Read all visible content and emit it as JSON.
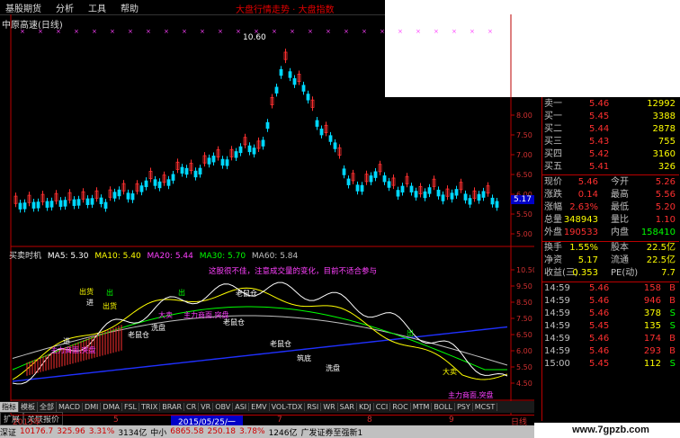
{
  "menu": {
    "items": [
      "基股期货",
      "分析",
      "工具",
      "帮助"
    ],
    "title": "大盘行情走势 · 大盘指数"
  },
  "stock": {
    "name": "中原高速(日线)"
  },
  "chart": {
    "peak_label": "10.60",
    "price_axis": [
      "8.00",
      "7.50",
      "7.00",
      "6.50",
      "6.00",
      "5.50",
      "5.00"
    ],
    "current_price_tag": "5.17",
    "indicator_axis": [
      "10.50",
      "9.50",
      "8.50",
      "7.50",
      "6.50",
      "6.00",
      "5.50",
      "4.50"
    ],
    "annotation": "这股很不佳，注意成交量的变化，目前不适合参与",
    "labels": [
      {
        "t": "出货",
        "c": "#ffff00"
      },
      {
        "t": "进",
        "c": "#ffffff"
      },
      {
        "t": "出",
        "c": "#00ff00"
      },
      {
        "t": "进",
        "c": "#ffffff"
      },
      {
        "t": "大卖",
        "c": "#ff40ff"
      },
      {
        "t": "老鼠仓",
        "c": "#ffffff"
      },
      {
        "t": "洗盘",
        "c": "#ffffff"
      },
      {
        "t": "出",
        "c": "#00ff00"
      },
      {
        "t": "老鼠仓",
        "c": "#ffffff"
      },
      {
        "t": "主力商面,突盘",
        "c": "#ff40ff"
      },
      {
        "t": "出货",
        "c": "#ffff00"
      },
      {
        "t": "老鼠仓",
        "c": "#ffffff"
      },
      {
        "t": "主力商面,突盘",
        "c": "#ff40ff"
      },
      {
        "t": "出",
        "c": "#00ff00"
      },
      {
        "t": "老鼠仓",
        "c": "#ffffff"
      },
      {
        "t": "主力商面,突盘",
        "c": "#ff40ff"
      },
      {
        "t": "筑底",
        "c": "#ffffff"
      },
      {
        "t": "洗盘",
        "c": "#ffffff"
      },
      {
        "t": "大卖",
        "c": "#ffff00"
      }
    ]
  },
  "ma_legend": {
    "name": "买卖时机",
    "items": [
      {
        "label": "MA5: 5.30",
        "color": "#ffffff"
      },
      {
        "label": "MA10: 5.40",
        "color": "#ffff00"
      },
      {
        "label": "MA20: 5.44",
        "color": "#ff40ff"
      },
      {
        "label": "MA30: 5.70",
        "color": "#00ff00"
      },
      {
        "label": "MA60: 5.84",
        "color": "#c0c0c0"
      }
    ]
  },
  "xaxis": {
    "labels": [
      "2015年",
      "5",
      "2015/05/25/一",
      "7",
      "8",
      "9",
      "日线"
    ]
  },
  "tabs": [
    "指标",
    "模板",
    "全部",
    "MACD",
    "DMI",
    "DMA",
    "FSL",
    "TRIX",
    "BRAR",
    "CR",
    "VR",
    "OBV",
    "ASI",
    "EMV",
    "VOL-TDX",
    "RSI",
    "WR",
    "SAR",
    "KDJ",
    "CCI",
    "ROC",
    "MTM",
    "BOLL",
    "PSY",
    "MCST"
  ],
  "tabs2": [
    "扩展",
    "关联报价"
  ],
  "quote": {
    "asks": [
      {
        "l": "卖一",
        "p": "5.46",
        "v": "12992"
      },
      {
        "l": "买一",
        "p": "5.45",
        "v": "3388"
      },
      {
        "l": "买二",
        "p": "5.44",
        "v": "2878"
      },
      {
        "l": "买三",
        "p": "5.43",
        "v": "755"
      },
      {
        "l": "买四",
        "p": "5.42",
        "v": "3160"
      },
      {
        "l": "买五",
        "p": "5.41",
        "v": "326"
      }
    ],
    "stats": [
      {
        "a": "现价",
        "b": "5.46",
        "c": "今开",
        "d": "5.26",
        "bc": "#ff3030",
        "dc": "#ff3030"
      },
      {
        "a": "涨跌",
        "b": "0.14",
        "c": "最高",
        "d": "5.56",
        "bc": "#ff3030",
        "dc": "#ff3030"
      },
      {
        "a": "涨幅",
        "b": "2.63%",
        "c": "最低",
        "d": "5.20",
        "bc": "#ff3030",
        "dc": "#ff3030"
      },
      {
        "a": "总量",
        "b": "348943",
        "c": "量比",
        "d": "1.10",
        "bc": "#ffff00",
        "dc": "#ff3030"
      },
      {
        "a": "外盘",
        "b": "190533",
        "c": "内盘",
        "d": "158410",
        "bc": "#ff3030",
        "dc": "#00ff00"
      }
    ],
    "fin": [
      {
        "a": "换手",
        "b": "1.55%",
        "c": "股本",
        "d": "22.5亿"
      },
      {
        "a": "净资",
        "b": "5.17",
        "c": "流通",
        "d": "22.5亿"
      },
      {
        "a": "收益(三)",
        "b": "0.353",
        "c": "PE(动)",
        "d": "7.7"
      }
    ],
    "ticks": [
      {
        "t": "14:59",
        "p": "5.46",
        "v": "158",
        "s": "B"
      },
      {
        "t": "14:59",
        "p": "5.46",
        "v": "946",
        "s": "B"
      },
      {
        "t": "14:59",
        "p": "5.46",
        "v": "378",
        "s": "S"
      },
      {
        "t": "14:59",
        "p": "5.45",
        "v": "135",
        "s": "S"
      },
      {
        "t": "14:59",
        "p": "5.46",
        "v": "174",
        "s": "B"
      },
      {
        "t": "14:59",
        "p": "5.46",
        "v": "293",
        "s": "B"
      },
      {
        "t": "15:00",
        "p": "5.45",
        "v": "112",
        "s": "S"
      }
    ]
  },
  "status": {
    "items": [
      {
        "t": "深证",
        "c": "#000"
      },
      {
        "t": "10176.7",
        "c": "#d00000"
      },
      {
        "t": "325.96",
        "c": "#d00000"
      },
      {
        "t": "3.31%",
        "c": "#d00000"
      },
      {
        "t": "3134亿",
        "c": "#000"
      },
      {
        "t": "中小",
        "c": "#000"
      },
      {
        "t": "6865.58",
        "c": "#d00000"
      },
      {
        "t": "250.18",
        "c": "#d00000"
      },
      {
        "t": "3.78%",
        "c": "#d00000"
      },
      {
        "t": "1246亿",
        "c": "#000"
      },
      {
        "t": "广发证券至强新1",
        "c": "#000"
      }
    ]
  },
  "watermark": "www.7gpzb.com"
}
